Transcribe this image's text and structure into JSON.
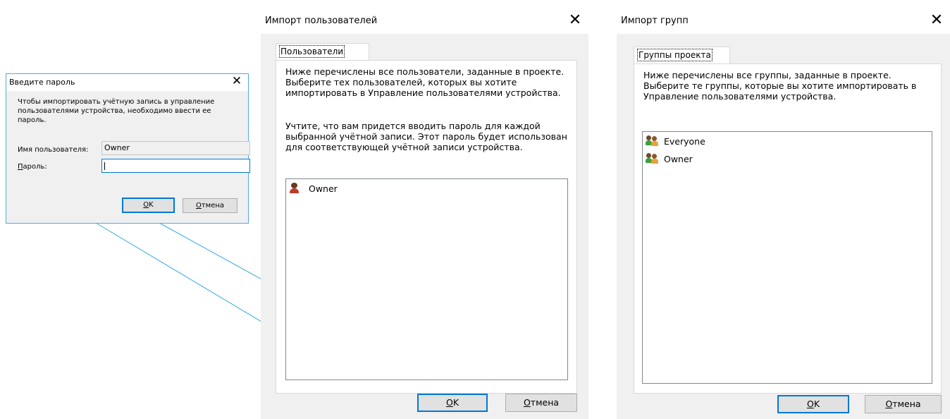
{
  "password_dialog": {
    "title": "Введите пароль",
    "description": "Чтобы импортировать учётную запись в управление пользователями устройства, необходимо ввести ее пароль.",
    "username_label": "Имя пользователя:",
    "username_value": "Owner",
    "password_label_accel": "П",
    "password_label_rest": "ароль:",
    "password_value": "",
    "ok_accel": "O",
    "ok_rest": "K",
    "cancel_accel": "О",
    "cancel_rest": "тмена",
    "close_glyph": "✕"
  },
  "import_users_dialog": {
    "title": "Импорт пользователей",
    "close_glyph": "✕",
    "tab_label": "Пользователи",
    "paragraph1": "Ниже перечислены все пользователи, заданные в проекте. Выберите тех пользователей, которых вы хотите импортировать в Управление пользователями устройства.",
    "paragraph2": "Учтите, что вам придется вводить пароль для каждой выбранной учётной записи. Этот пароль будет использован для соответствующей учётной записи устройства.",
    "users": [
      {
        "name": "Owner",
        "icon": "user-icon"
      }
    ],
    "ok_accel": "O",
    "ok_rest": "K",
    "cancel_accel": "О",
    "cancel_rest": "тмена"
  },
  "import_groups_dialog": {
    "title": "Импорт групп",
    "close_glyph": "✕",
    "tab_label": "Группы проекта",
    "paragraph": "Ниже перечислены все группы, заданные в проекте. Выберите те группы, которые вы хотите импортировать в Управление пользователями устройства.",
    "groups": [
      {
        "name": "Everyone",
        "icon": "group-icon"
      },
      {
        "name": "Owner",
        "icon": "group-icon"
      }
    ],
    "ok_accel": "O",
    "ok_rest": "K",
    "cancel_accel": "О",
    "cancel_rest": "тмена"
  },
  "colors": {
    "accent": "#0078d7",
    "callout": "#2aa8e0",
    "dialog_bg": "#f0f0f0"
  }
}
